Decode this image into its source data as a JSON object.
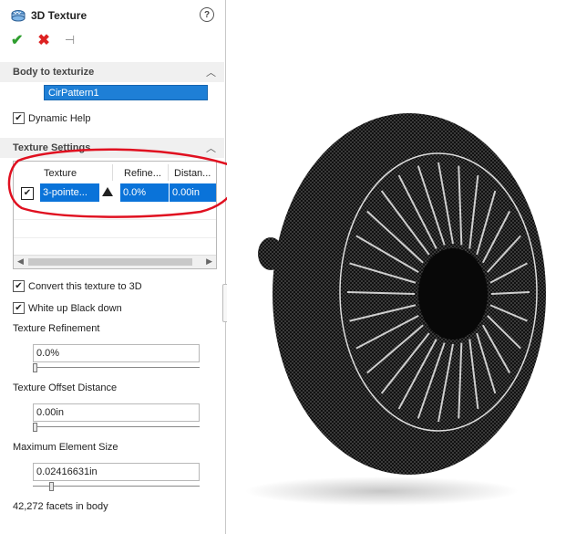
{
  "panel": {
    "title": "3D Texture",
    "help_glyph": "?",
    "actions": {
      "ok": "✔",
      "cancel": "✖",
      "pin": "⊣"
    },
    "body_section": {
      "label": "Body to texturize",
      "selected_body": "CirPattern1",
      "dynamic_help_label": "Dynamic Help",
      "dynamic_help_checked": true
    },
    "texture_section": {
      "label": "Texture Settings",
      "table": {
        "columns": [
          "Texture",
          "Refine...",
          "Distan..."
        ],
        "rows": [
          {
            "texture": "3-pointe...",
            "refinement": "0.0%",
            "distance": "0.00in",
            "checked": true
          }
        ]
      },
      "convert_label": "Convert this texture to 3D",
      "convert_checked": true,
      "white_up_label": "White up Black down",
      "white_up_checked": true,
      "refinement_label": "Texture Refinement",
      "refinement_value": "0.0%",
      "offset_label": "Texture Offset Distance",
      "offset_value": "0.00in",
      "max_element_label": "Maximum Element Size",
      "max_element_value": "0.02416631in",
      "facets_text": "42,272 facets in body"
    }
  },
  "colors": {
    "selection_blue": "#0a73d9",
    "annotation_red": "#e01020",
    "ok_green": "#2f9e2f",
    "cancel_red": "#dd2222"
  },
  "slider_levels": {
    "refinement": 0.0,
    "offset": 0.0,
    "max_element": 0.1
  }
}
